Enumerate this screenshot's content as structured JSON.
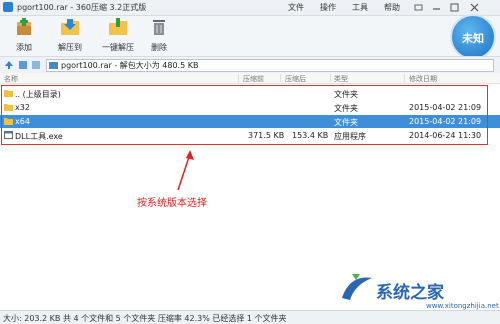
{
  "window": {
    "title": "pgort100.rar - 360压缩 3.2正式版",
    "menu": [
      "文件",
      "操作",
      "工具",
      "帮助"
    ]
  },
  "toolbar": {
    "buttons": [
      {
        "label": "添加",
        "icon": "add-icon"
      },
      {
        "label": "解压到",
        "icon": "extract-to-icon"
      },
      {
        "label": "一键解压",
        "icon": "one-click-extract-icon"
      },
      {
        "label": "删除",
        "icon": "delete-icon"
      }
    ]
  },
  "badge": {
    "label": "未知"
  },
  "address": {
    "text": "pgort100.rar - 解包大小为 480.5 KB"
  },
  "columns": [
    "名称",
    "压缩前",
    "压缩后",
    "类型",
    "修改日期"
  ],
  "files": [
    {
      "name": ".. (上级目录)",
      "before": "",
      "after": "",
      "type": "文件夹",
      "date": "",
      "icon": "folder-up-icon",
      "selected": false
    },
    {
      "name": "x32",
      "before": "",
      "after": "",
      "type": "文件夹",
      "date": "2015-04-02 21:09",
      "icon": "folder-icon",
      "selected": false
    },
    {
      "name": "x64",
      "before": "",
      "after": "",
      "type": "文件夹",
      "date": "2015-04-02 21:09",
      "icon": "folder-icon",
      "selected": true
    },
    {
      "name": "DLL工具.exe",
      "before": "371.5 KB",
      "after": "153.4 KB",
      "type": "应用程序",
      "date": "2014-06-24 11:30",
      "icon": "exe-file-icon",
      "selected": false
    }
  ],
  "annotation": {
    "text": "按系统版本选择"
  },
  "status": {
    "text": "大小: 203.2 KB 共 4 个文件和 5 个文件夹 压缩率 42.3% 已经选择 1 个文件夹"
  },
  "watermark": {
    "text": "系统之家",
    "url": "www.xitongzhijia.net"
  },
  "colors": {
    "selection": "#3f8fd8",
    "annotation": "#dd2222",
    "badge": "#1f6fc2"
  }
}
